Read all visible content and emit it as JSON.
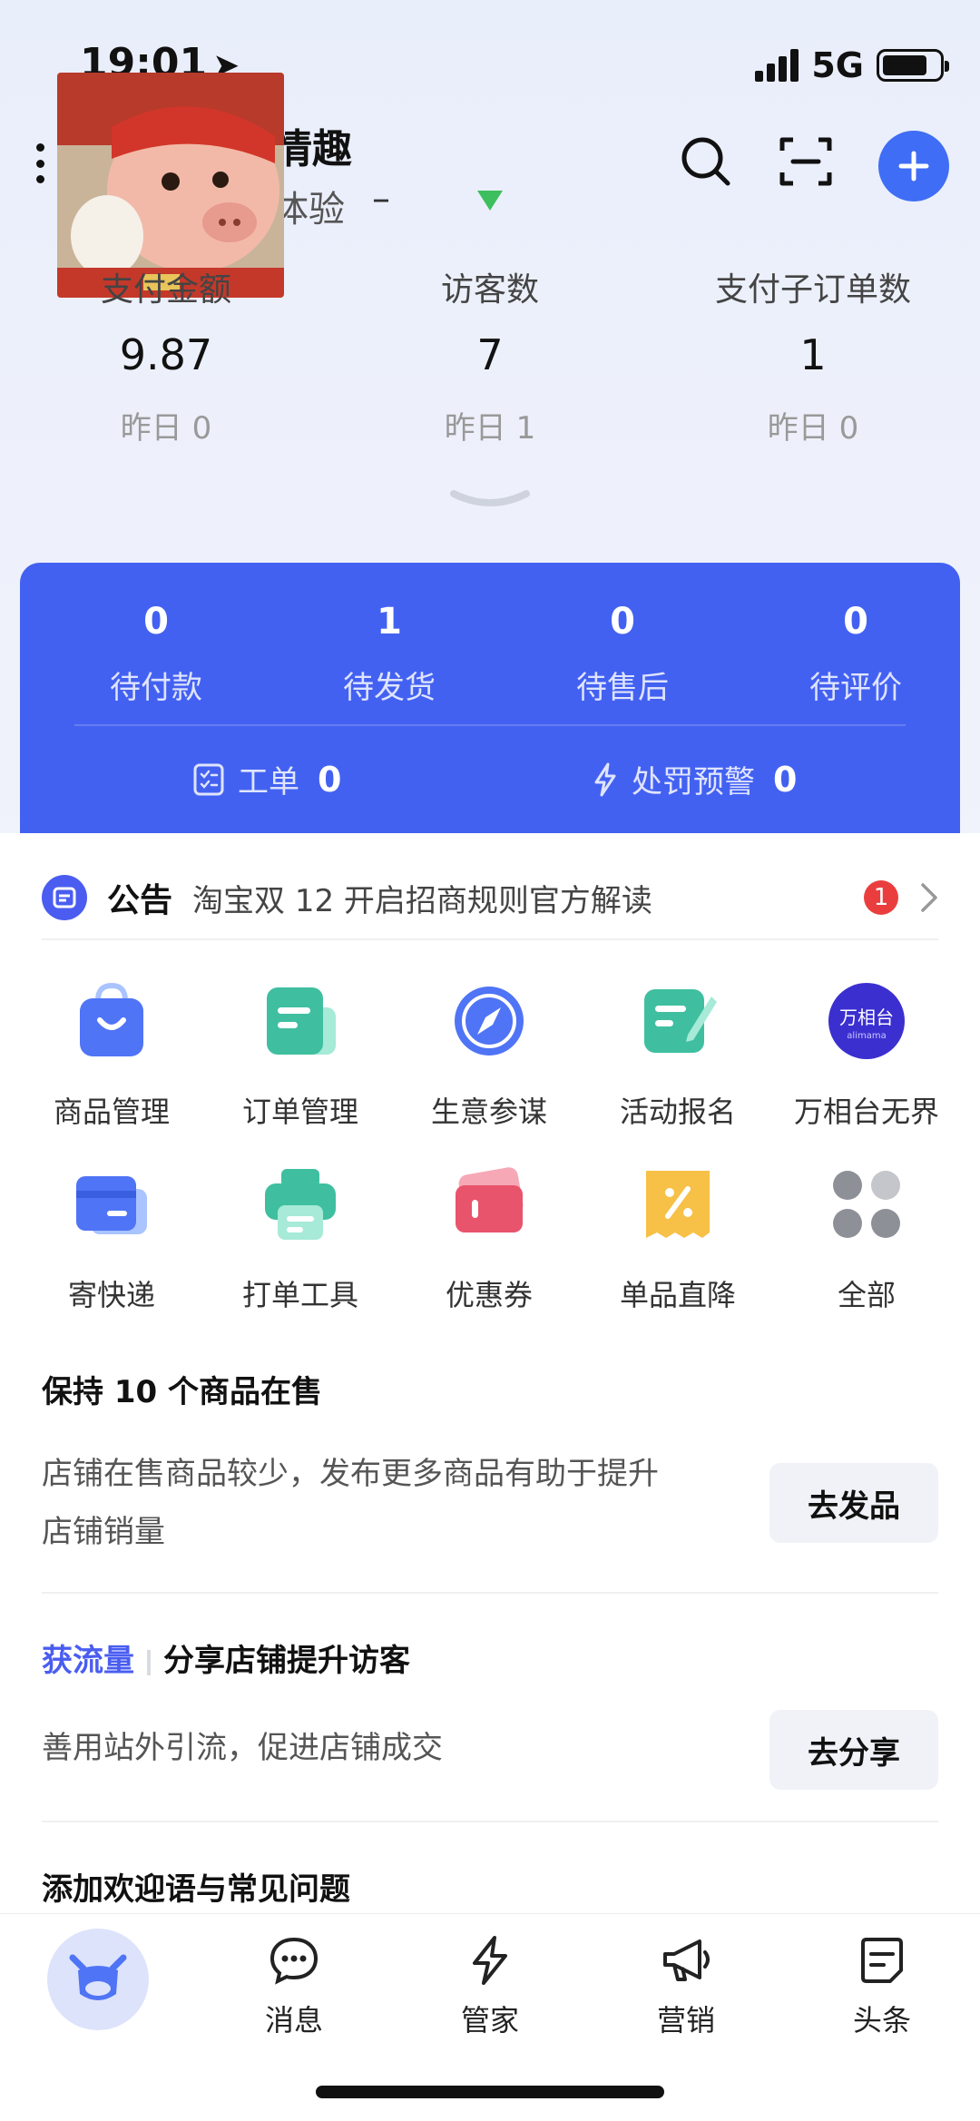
{
  "status_bar": {
    "time": "19:01",
    "network": "5G"
  },
  "header": {
    "shop_name": "情趣",
    "shop_sub": "体验",
    "shop_sub_extra": "–"
  },
  "stats": [
    {
      "label": "支付金额",
      "value": "9.87",
      "yesterday": "昨日 0"
    },
    {
      "label": "访客数",
      "value": "7",
      "yesterday": "昨日 1"
    },
    {
      "label": "支付子订单数",
      "value": "1",
      "yesterday": "昨日 0"
    }
  ],
  "orders": {
    "items": [
      {
        "count": "0",
        "label": "待付款"
      },
      {
        "count": "1",
        "label": "待发货"
      },
      {
        "count": "0",
        "label": "待售后"
      },
      {
        "count": "0",
        "label": "待评价"
      }
    ],
    "ticket_label": "工单",
    "ticket_count": "0",
    "penalty_label": "处罚预警",
    "penalty_count": "0"
  },
  "notice": {
    "title": "公告",
    "text": "淘宝双 12 开启招商规则官方解读",
    "badge": "1"
  },
  "tools": [
    {
      "label": "商品管理",
      "icon": "bag-icon"
    },
    {
      "label": "订单管理",
      "icon": "order-doc-icon"
    },
    {
      "label": "生意参谋",
      "icon": "compass-icon"
    },
    {
      "label": "活动报名",
      "icon": "signup-pen-icon"
    },
    {
      "label": "万相台无界",
      "icon": "wanxiangtai-logo",
      "logo_text": "万相台",
      "logo_sub": "alimama"
    },
    {
      "label": "寄快递",
      "icon": "express-card-icon"
    },
    {
      "label": "打单工具",
      "icon": "printer-icon"
    },
    {
      "label": "优惠券",
      "icon": "coupon-icon"
    },
    {
      "label": "单品直降",
      "icon": "discount-tag-icon"
    },
    {
      "label": "全部",
      "icon": "all-grid-icon"
    }
  ],
  "tasks": {
    "keep_items": {
      "title": "保持 10 个商品在售",
      "desc_line1": "店铺在售商品较少，发布更多商品有助于提升",
      "desc_line2": "店铺销量",
      "button": "去发品"
    },
    "traffic": {
      "tag": "获流量",
      "title": "分享店铺提升访客",
      "desc": "善用站外引流，促进店铺成交",
      "button": "去分享"
    },
    "welcome": {
      "title": "添加欢迎语与常见问题"
    }
  },
  "tabbar": [
    {
      "label": "消息",
      "icon": "message-icon"
    },
    {
      "label": "管家",
      "icon": "lightning-icon"
    },
    {
      "label": "营销",
      "icon": "megaphone-icon"
    },
    {
      "label": "头条",
      "icon": "news-icon"
    }
  ],
  "colors": {
    "accent": "#4361f1",
    "badge": "#ea3e3e",
    "tag": "#4a5df0"
  }
}
